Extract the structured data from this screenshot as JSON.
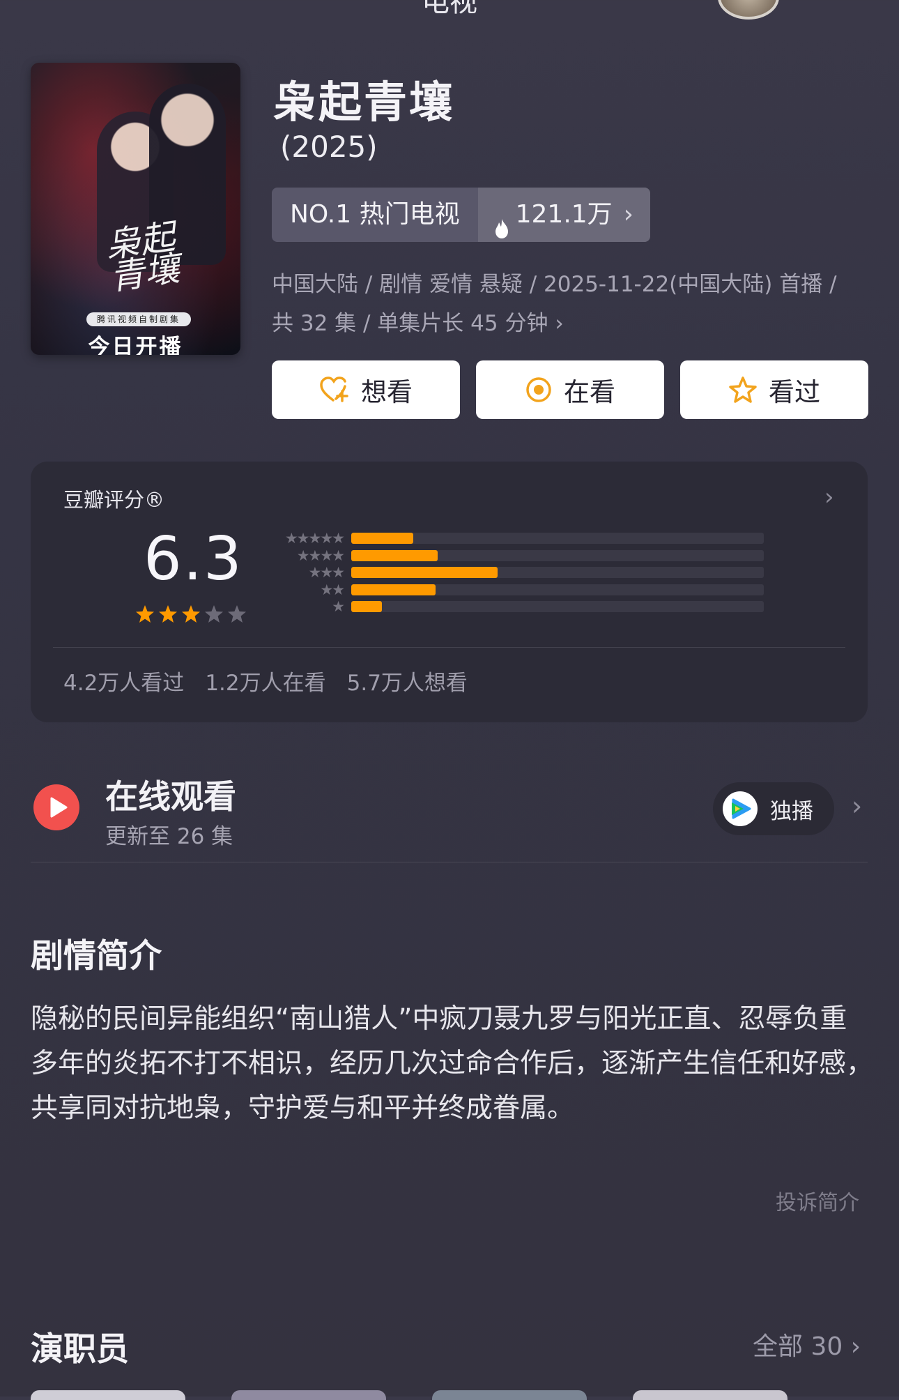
{
  "nav": {
    "title": "电视"
  },
  "show": {
    "title": "枭起青壤",
    "year": "(2025)",
    "poster_title": "枭起青壤",
    "poster_small": "腾讯视频自制剧集",
    "poster_premiere": "今日开播",
    "rank_label": "NO.1 热门电视",
    "heat": "121.1万",
    "meta_line1": "中国大陆 / 剧情 爱情 悬疑 / 2025-11-22(中国大陆) 首播 /",
    "meta_line2": "共 32 集 / 单集片长 45 分钟"
  },
  "actions": [
    {
      "label": "想看",
      "icon": "heart-plus-icon"
    },
    {
      "label": "在看",
      "icon": "target-icon"
    },
    {
      "label": "看过",
      "icon": "star-outline-icon"
    }
  ],
  "rating": {
    "label": "豆瓣评分®",
    "score": "6.3",
    "stars": 3,
    "distribution": [
      {
        "stars": "★★★★★",
        "fraction": 0.15
      },
      {
        "stars": "★★★★",
        "fraction": 0.21
      },
      {
        "stars": "★★★",
        "fraction": 0.355
      },
      {
        "stars": "★★",
        "fraction": 0.205
      },
      {
        "stars": "★",
        "fraction": 0.075
      }
    ],
    "watched": "4.2万人看过",
    "watching": "1.2万人在看",
    "want": "5.7万人想看"
  },
  "online": {
    "title": "在线观看",
    "subtitle": "更新至 26 集",
    "exclusive_label": "独播"
  },
  "synopsis": {
    "title": "剧情简介",
    "text": "隐秘的民间异能组织“南山猎人”中疯刀聂九罗与阳光正直、忍辱负重多年的炎拓不打不相识，经历几次过命合作后，逐渐产生信任和好感，共享同对抗地枭，守护爱与和平并终成眷属。",
    "report": "投诉简介"
  },
  "cast": {
    "title": "演职员",
    "all_label": "全部 30"
  },
  "colors": {
    "background": "#353444",
    "card": "#2c2b37",
    "accent_orange": "#ff9a00",
    "play_red": "#f2514e"
  }
}
